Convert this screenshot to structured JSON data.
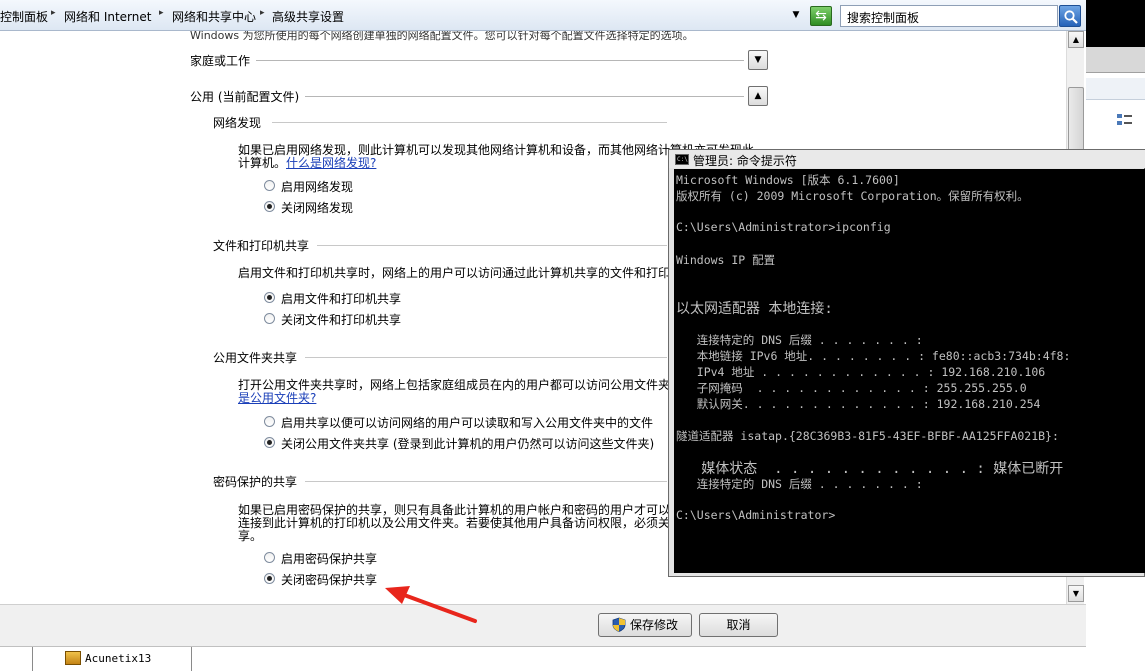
{
  "breadcrumb": {
    "items": [
      "控制面板",
      "网络和 Internet",
      "网络和共享中心",
      "高级共享设置"
    ]
  },
  "search": {
    "value": "搜索控制面板"
  },
  "settings": {
    "cut_off_text": "Windows 为您所使用的每个网络创建单独的网络配置文件。您可以针对每个配置文件选择特定的选项。",
    "groups": [
      {
        "title": "家庭或工作",
        "expanded": false
      },
      {
        "title": "公用 (当前配置文件)",
        "expanded": true
      }
    ],
    "sections": [
      {
        "title": "网络发现",
        "desc_lines": [
          "如果已启用网络发现，则此计算机可以发现其他网络计算机和设备，而其他网络计算机亦可发现此",
          "计算机。"
        ],
        "link": "什么是网络发现?",
        "options": [
          {
            "label": "启用网络发现",
            "checked": false
          },
          {
            "label": "关闭网络发现",
            "checked": true
          }
        ]
      },
      {
        "title": "文件和打印机共享",
        "desc_lines": [
          "启用文件和打印机共享时，网络上的用户可以访问通过此计算机共享的文件和打印机。"
        ],
        "options": [
          {
            "label": "启用文件和打印机共享",
            "checked": true
          },
          {
            "label": "关闭文件和打印机共享",
            "checked": false
          }
        ]
      },
      {
        "title": "公用文件夹共享",
        "desc_lines": [
          "打开公用文件夹共享时，网络上包括家庭组成员在内的用户都可以访问公用文件夹中的文件。"
        ],
        "link": "是公用文件夹?",
        "options": [
          {
            "label": "启用共享以便可以访问网络的用户可以读取和写入公用文件夹中的文件",
            "checked": false
          },
          {
            "label": "关闭公用文件夹共享 (登录到此计算机的用户仍然可以访问这些文件夹)",
            "checked": true
          }
        ]
      },
      {
        "title": "密码保护的共享",
        "desc_lines": [
          "如果已启用密码保护的共享，则只有具备此计算机的用户帐户和密码的用户才可以访问共享文件、",
          "连接到此计算机的打印机以及公用文件夹。若要使其他用户具备访问权限，必须关闭密码保护的共",
          "享。"
        ],
        "options": [
          {
            "label": "启用密码保护共享",
            "checked": false
          },
          {
            "label": "关闭密码保护共享",
            "checked": true
          }
        ]
      }
    ]
  },
  "buttons": {
    "save": "保存修改",
    "cancel": "取消"
  },
  "taskbar": {
    "item": "Acunetix13"
  },
  "cmd": {
    "title": "管理员: 命令提示符",
    "lines": [
      "Microsoft Windows [版本 6.1.7600]",
      "版权所有 (c) 2009 Microsoft Corporation。保留所有权利。",
      "",
      "C:\\Users\\Administrator>ipconfig",
      "",
      "Windows IP 配置",
      "",
      "",
      "以太网适配器 本地连接:",
      "",
      "   连接特定的 DNS 后缀 . . . . . . . :",
      "   本地链接 IPv6 地址. . . . . . . . : fe80::acb3:734b:4f8:",
      "   IPv4 地址 . . . . . . . . . . . . : 192.168.210.106",
      "   子网掩码  . . . . . . . . . . . . : 255.255.255.0",
      "   默认网关. . . . . . . . . . . . . : 192.168.210.254",
      "",
      "隧道适配器 isatap.{28C369B3-81F5-43EF-BFBF-AA125FFA021B}:",
      "",
      "   媒体状态  . . . . . . . . . . . . : 媒体已断开",
      "   连接特定的 DNS 后缀 . . . . . . . :",
      "",
      "C:\\Users\\Administrator>"
    ]
  },
  "colors": {
    "link": "#1a3fb8",
    "annotation_arrow": "#e8261c",
    "cmd_text": "#c0c0c0"
  }
}
